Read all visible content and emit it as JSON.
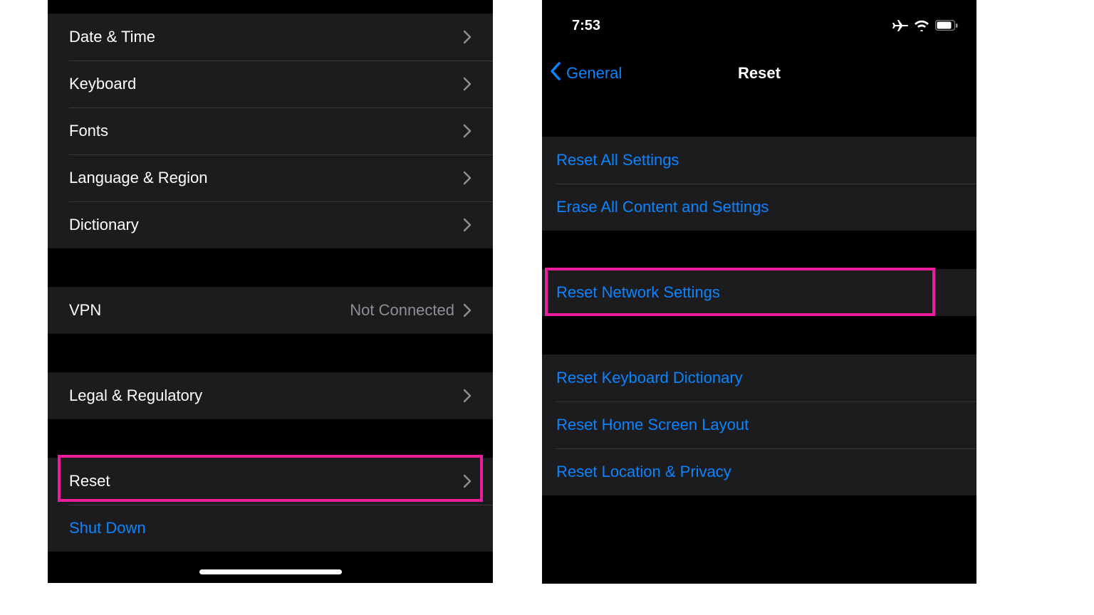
{
  "left": {
    "group1": [
      {
        "label": "Date & Time"
      },
      {
        "label": "Keyboard"
      },
      {
        "label": "Fonts"
      },
      {
        "label": "Language & Region"
      },
      {
        "label": "Dictionary"
      }
    ],
    "vpn": {
      "label": "VPN",
      "value": "Not Connected"
    },
    "legal": {
      "label": "Legal & Regulatory"
    },
    "reset": {
      "label": "Reset"
    },
    "shutdown": {
      "label": "Shut Down"
    }
  },
  "right": {
    "status_time": "7:53",
    "nav_back": "General",
    "nav_title": "Reset",
    "group1": [
      "Reset All Settings",
      "Erase All Content and Settings"
    ],
    "network": "Reset Network Settings",
    "group3": [
      "Reset Keyboard Dictionary",
      "Reset Home Screen Layout",
      "Reset Location & Privacy"
    ]
  },
  "colors": {
    "link": "#0a84ff",
    "highlight": "#ed1e9b"
  }
}
